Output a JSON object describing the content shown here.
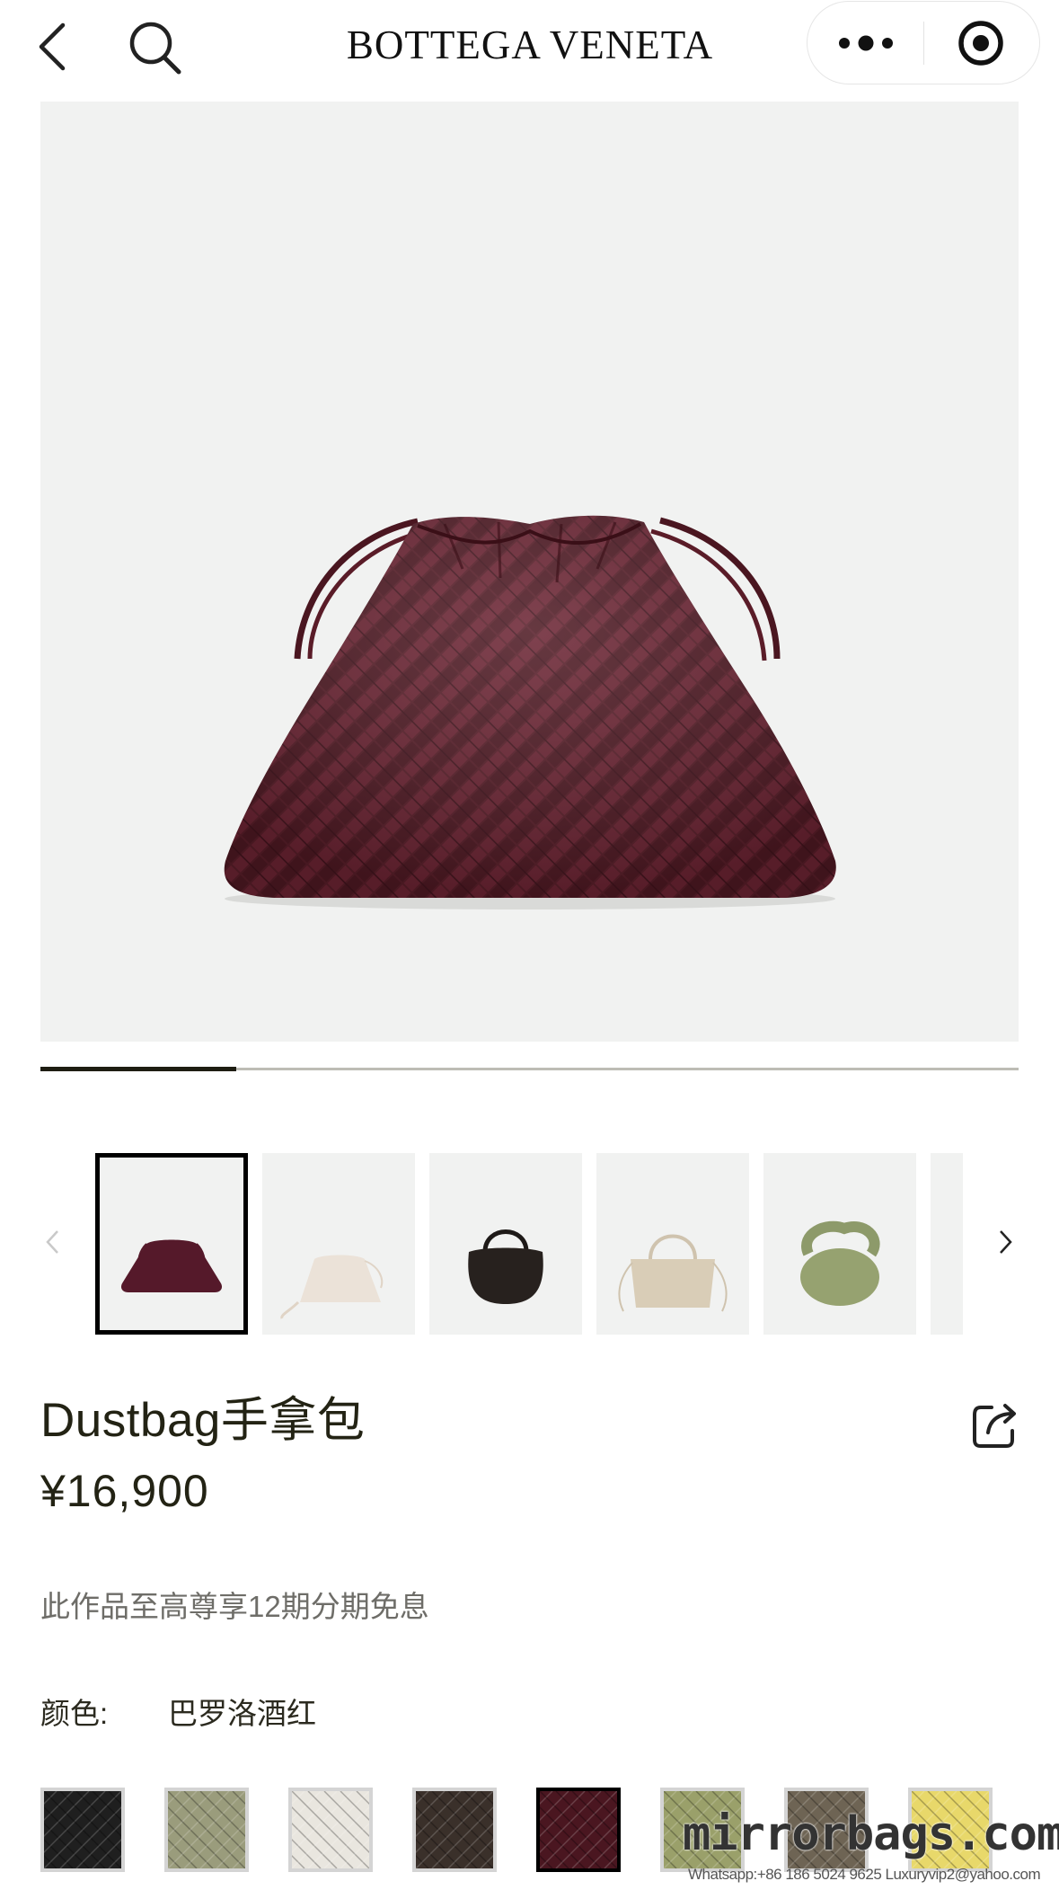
{
  "topbar": {
    "brand": "BOTTEGA VENETA",
    "icons": [
      "back-arrow-icon",
      "search-icon",
      "more-dots-icon",
      "target-circle-icon"
    ]
  },
  "hero": {
    "image": "burgundy-intrecciato-drawstring-pouch",
    "gallery_progress": 0.2
  },
  "thumbnails": {
    "prev_icon": "chevron-left-icon",
    "next_icon": "chevron-right-icon",
    "items": [
      {
        "image": "burgundy-pouch",
        "selected": true
      },
      {
        "image": "cream-pouch-with-strap",
        "selected": false
      },
      {
        "image": "black-hobo-bag",
        "selected": false
      },
      {
        "image": "beige-woven-tote",
        "selected": false
      },
      {
        "image": "sage-knot-bag",
        "selected": false
      },
      {
        "image": "partial-thumbnail",
        "selected": false
      }
    ]
  },
  "product": {
    "title": "Dustbag手拿包",
    "price": "¥16,900",
    "installment_note": "此作品至高尊享12期分期免息",
    "color_label": "颜色:",
    "color_value": "巴罗洛酒红",
    "share_icon": "share-icon"
  },
  "swatches": [
    {
      "color": "#1f1f1f",
      "selected": false
    },
    {
      "color": "#9a9c7c",
      "selected": false
    },
    {
      "color": "#e9e6df",
      "selected": false
    },
    {
      "color": "#3a302a",
      "selected": false
    },
    {
      "color": "#4a1620",
      "selected": true
    },
    {
      "color": "#9aa06a",
      "selected": false
    },
    {
      "color": "#6e6454",
      "selected": false
    },
    {
      "color": "#e8d86a",
      "selected": false
    }
  ],
  "watermark": {
    "main": "mirrorbags.com",
    "sub": "Whatsapp:+86 186 5024 9625   Luxuryvip2@yahoo.com"
  }
}
